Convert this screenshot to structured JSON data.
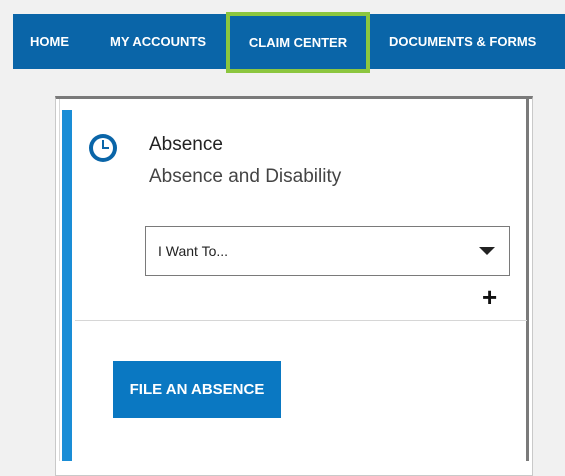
{
  "nav": {
    "items": [
      {
        "label": "HOME"
      },
      {
        "label": "MY ACCOUNTS"
      },
      {
        "label": "CLAIM CENTER",
        "highlighted": true
      },
      {
        "label": "DOCUMENTS & FORMS"
      }
    ]
  },
  "card": {
    "icon": "clock-icon",
    "title": "Absence",
    "subtitle": "Absence and Disability",
    "select": {
      "value": "I Want To..."
    },
    "add_icon": "plus-icon",
    "action_button": "FILE AN ABSENCE"
  },
  "colors": {
    "nav_bg": "#0a65a8",
    "highlight": "#8cc63f",
    "accent": "#1a8dd6",
    "button_bg": "#0a78c2"
  }
}
